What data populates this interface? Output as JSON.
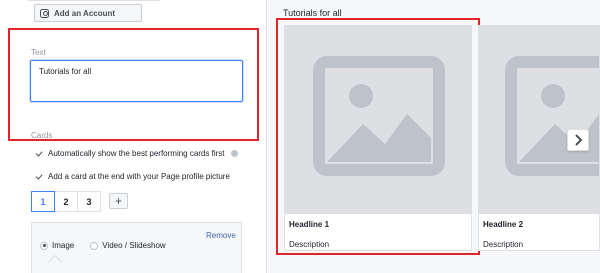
{
  "account": {
    "add_account_label": "Add an Account",
    "icon": "instagram-icon"
  },
  "text_section": {
    "label": "Text",
    "value": "Tutorials for all"
  },
  "cards_section": {
    "label": "Cards",
    "auto_best_label": "Automatically show the best performing cards first",
    "add_profile_card_label": "Add a card at the end with your Page profile picture",
    "tabs": [
      "1",
      "2",
      "3"
    ],
    "active_tab": "1",
    "add_tab_label": "+",
    "remove_label": "Remove",
    "media_options": [
      "Image",
      "Video / Slideshow"
    ],
    "selected_media": "Image"
  },
  "preview": {
    "title": "Tutorials for all",
    "cards": [
      {
        "headline": "Headline 1",
        "description": "Description"
      },
      {
        "headline": "Headline 2",
        "description": "Description"
      }
    ]
  },
  "colors": {
    "highlight": "#e4242b",
    "accent": "#4080ff",
    "link": "#4267b2",
    "placeholder": "#dddfe2"
  }
}
